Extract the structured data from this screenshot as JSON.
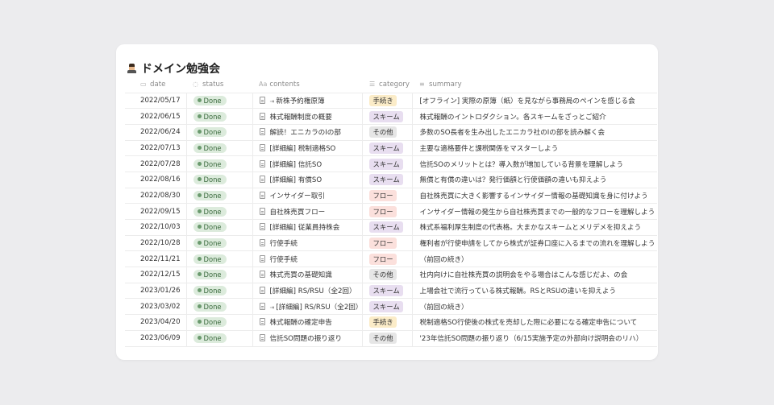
{
  "title": "ドメイン勉強会",
  "title_icon": "person-emoji-icon",
  "columns": {
    "date": "date",
    "status": "status",
    "contents": "contents",
    "category": "category",
    "summary": "summary",
    "contents_prefix": "Aa"
  },
  "category_colors": {
    "手続き": "#fbecc8",
    "スキーム": "#e8def0",
    "その他": "#e6e6e6",
    "フロー": "#fbe0dc"
  },
  "rows": [
    {
      "date": "2022/05/17",
      "status": "Done",
      "contents": "新株予約権原簿",
      "linked": true,
      "category": "手続き",
      "summary": "[オフライン] 実際の原簿（紙）を見ながら事務局のペインを感じる会"
    },
    {
      "date": "2022/06/15",
      "status": "Done",
      "contents": "株式報酬制度の概要",
      "category": "スキーム",
      "summary": "株式報酬のイントロダクション。各スキームをざっとご紹介"
    },
    {
      "date": "2022/06/24",
      "status": "Done",
      "contents": "解読！エニカラのIの部",
      "category": "その他",
      "summary": "多数のSO長者を生み出したエニカラ社のIの部を読み解く会"
    },
    {
      "date": "2022/07/13",
      "status": "Done",
      "contents": "[詳細編] 税制適格SO",
      "category": "スキーム",
      "summary": "主要な適格要件と課税関係をマスターしよう"
    },
    {
      "date": "2022/07/28",
      "status": "Done",
      "contents": "[詳細編] 信託SO",
      "category": "スキーム",
      "summary": "信託SOのメリットとは？導入数が増加している背景を理解しよう"
    },
    {
      "date": "2022/08/16",
      "status": "Done",
      "contents": "[詳細編] 有償SO",
      "category": "スキーム",
      "summary": "無償と有償の違いは？発行価額と行使価額の違いも抑えよう"
    },
    {
      "date": "2022/08/30",
      "status": "Done",
      "contents": "インサイダー取引",
      "category": "フロー",
      "summary": "自社株売買に大きく影響するインサイダー情報の基礎知識を身に付けよう"
    },
    {
      "date": "2022/09/15",
      "status": "Done",
      "contents": "自社株売買フロー",
      "category": "フロー",
      "summary": "インサイダー情報の発生から自社株売買までの一般的なフローを理解しよう"
    },
    {
      "date": "2022/10/03",
      "status": "Done",
      "contents": "[詳細編] 従業員持株会",
      "category": "スキーム",
      "summary": "株式系福利厚生制度の代表格。大まかなスキームとメリデメを抑えよう"
    },
    {
      "date": "2022/10/28",
      "status": "Done",
      "contents": "行使手続",
      "category": "フロー",
      "summary": "権利者が行使申請をしてから株式が証券口座に入るまでの流れを理解しよう"
    },
    {
      "date": "2022/11/21",
      "status": "Done",
      "contents": "行使手続",
      "category": "フロー",
      "summary": "（前回の続き）"
    },
    {
      "date": "2022/12/15",
      "status": "Done",
      "contents": "株式売買の基礎知識",
      "category": "その他",
      "summary": "社内向けに自社株売買の説明会をやる場合はこんな感じだよ、の会"
    },
    {
      "date": "2023/01/26",
      "status": "Done",
      "contents": "[詳細編] RS/RSU（全2回）",
      "category": "スキーム",
      "summary": "上場会社で流行っている株式報酬。RSとRSUの違いを抑えよう"
    },
    {
      "date": "2023/03/02",
      "status": "Done",
      "contents": "[詳細編] RS/RSU（全2回）",
      "linked": true,
      "category": "スキーム",
      "summary": "（前回の続き）"
    },
    {
      "date": "2023/04/20",
      "status": "Done",
      "contents": "株式報酬の確定申告",
      "category": "手続き",
      "summary": "税制適格SO行使後の株式を売却した際に必要になる確定申告について"
    },
    {
      "date": "2023/06/09",
      "status": "Done",
      "contents": "信託SO問題の振り返り",
      "category": "その他",
      "summary": "'23年信託SO問題の振り返り（6/15実施予定の外部向け説明会のリハ）"
    }
  ]
}
